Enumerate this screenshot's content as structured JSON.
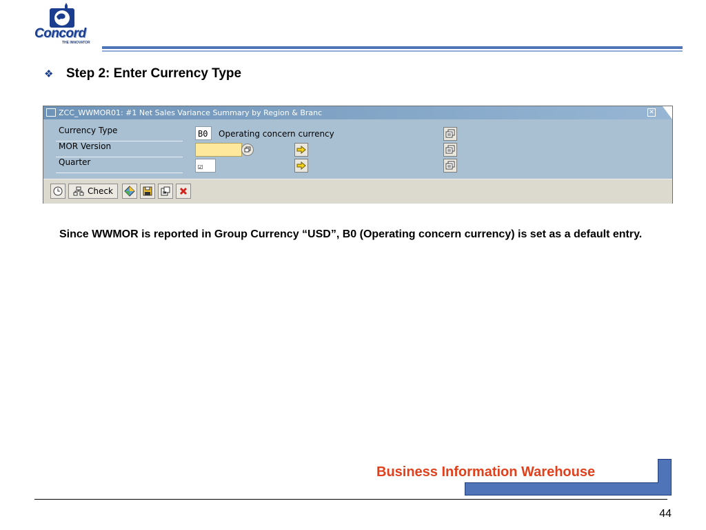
{
  "logo": {
    "brand": "Concord",
    "tagline": "THE INNOVATOR"
  },
  "heading": {
    "bullet": "❖",
    "text": "Step 2: Enter Currency Type"
  },
  "sap_window": {
    "title": "ZCC_WWMOR01: #1 Net Sales Variance Summary by Region & Branc",
    "rows": [
      {
        "label": "Currency Type",
        "value": "B0",
        "description": "Operating concern currency"
      },
      {
        "label": "MOR Version",
        "value": "",
        "description": ""
      },
      {
        "label": "Quarter",
        "value": "☑",
        "description": ""
      }
    ],
    "toolbar": {
      "check_label": "Check"
    }
  },
  "note": "Since WWMOR is reported in Group Currency “USD”, B0 (Operating concern currency) is set as a default entry.",
  "footer": {
    "title": "Business Information Warehouse",
    "page": "44"
  },
  "colors": {
    "brand_blue": "#4f74b8",
    "footer_title": "#e0401c",
    "sap_body": "#a9c0d3",
    "required_field": "#fde89b"
  }
}
